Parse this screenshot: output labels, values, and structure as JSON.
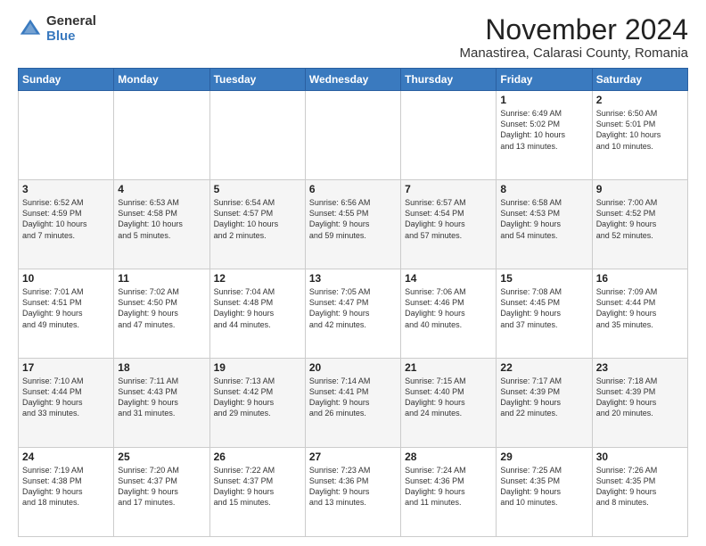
{
  "logo": {
    "general": "General",
    "blue": "Blue"
  },
  "header": {
    "month": "November 2024",
    "location": "Manastirea, Calarasi County, Romania"
  },
  "weekdays": [
    "Sunday",
    "Monday",
    "Tuesday",
    "Wednesday",
    "Thursday",
    "Friday",
    "Saturday"
  ],
  "weeks": [
    [
      {
        "day": "",
        "info": ""
      },
      {
        "day": "",
        "info": ""
      },
      {
        "day": "",
        "info": ""
      },
      {
        "day": "",
        "info": ""
      },
      {
        "day": "",
        "info": ""
      },
      {
        "day": "1",
        "info": "Sunrise: 6:49 AM\nSunset: 5:02 PM\nDaylight: 10 hours\nand 13 minutes."
      },
      {
        "day": "2",
        "info": "Sunrise: 6:50 AM\nSunset: 5:01 PM\nDaylight: 10 hours\nand 10 minutes."
      }
    ],
    [
      {
        "day": "3",
        "info": "Sunrise: 6:52 AM\nSunset: 4:59 PM\nDaylight: 10 hours\nand 7 minutes."
      },
      {
        "day": "4",
        "info": "Sunrise: 6:53 AM\nSunset: 4:58 PM\nDaylight: 10 hours\nand 5 minutes."
      },
      {
        "day": "5",
        "info": "Sunrise: 6:54 AM\nSunset: 4:57 PM\nDaylight: 10 hours\nand 2 minutes."
      },
      {
        "day": "6",
        "info": "Sunrise: 6:56 AM\nSunset: 4:55 PM\nDaylight: 9 hours\nand 59 minutes."
      },
      {
        "day": "7",
        "info": "Sunrise: 6:57 AM\nSunset: 4:54 PM\nDaylight: 9 hours\nand 57 minutes."
      },
      {
        "day": "8",
        "info": "Sunrise: 6:58 AM\nSunset: 4:53 PM\nDaylight: 9 hours\nand 54 minutes."
      },
      {
        "day": "9",
        "info": "Sunrise: 7:00 AM\nSunset: 4:52 PM\nDaylight: 9 hours\nand 52 minutes."
      }
    ],
    [
      {
        "day": "10",
        "info": "Sunrise: 7:01 AM\nSunset: 4:51 PM\nDaylight: 9 hours\nand 49 minutes."
      },
      {
        "day": "11",
        "info": "Sunrise: 7:02 AM\nSunset: 4:50 PM\nDaylight: 9 hours\nand 47 minutes."
      },
      {
        "day": "12",
        "info": "Sunrise: 7:04 AM\nSunset: 4:48 PM\nDaylight: 9 hours\nand 44 minutes."
      },
      {
        "day": "13",
        "info": "Sunrise: 7:05 AM\nSunset: 4:47 PM\nDaylight: 9 hours\nand 42 minutes."
      },
      {
        "day": "14",
        "info": "Sunrise: 7:06 AM\nSunset: 4:46 PM\nDaylight: 9 hours\nand 40 minutes."
      },
      {
        "day": "15",
        "info": "Sunrise: 7:08 AM\nSunset: 4:45 PM\nDaylight: 9 hours\nand 37 minutes."
      },
      {
        "day": "16",
        "info": "Sunrise: 7:09 AM\nSunset: 4:44 PM\nDaylight: 9 hours\nand 35 minutes."
      }
    ],
    [
      {
        "day": "17",
        "info": "Sunrise: 7:10 AM\nSunset: 4:44 PM\nDaylight: 9 hours\nand 33 minutes."
      },
      {
        "day": "18",
        "info": "Sunrise: 7:11 AM\nSunset: 4:43 PM\nDaylight: 9 hours\nand 31 minutes."
      },
      {
        "day": "19",
        "info": "Sunrise: 7:13 AM\nSunset: 4:42 PM\nDaylight: 9 hours\nand 29 minutes."
      },
      {
        "day": "20",
        "info": "Sunrise: 7:14 AM\nSunset: 4:41 PM\nDaylight: 9 hours\nand 26 minutes."
      },
      {
        "day": "21",
        "info": "Sunrise: 7:15 AM\nSunset: 4:40 PM\nDaylight: 9 hours\nand 24 minutes."
      },
      {
        "day": "22",
        "info": "Sunrise: 7:17 AM\nSunset: 4:39 PM\nDaylight: 9 hours\nand 22 minutes."
      },
      {
        "day": "23",
        "info": "Sunrise: 7:18 AM\nSunset: 4:39 PM\nDaylight: 9 hours\nand 20 minutes."
      }
    ],
    [
      {
        "day": "24",
        "info": "Sunrise: 7:19 AM\nSunset: 4:38 PM\nDaylight: 9 hours\nand 18 minutes."
      },
      {
        "day": "25",
        "info": "Sunrise: 7:20 AM\nSunset: 4:37 PM\nDaylight: 9 hours\nand 17 minutes."
      },
      {
        "day": "26",
        "info": "Sunrise: 7:22 AM\nSunset: 4:37 PM\nDaylight: 9 hours\nand 15 minutes."
      },
      {
        "day": "27",
        "info": "Sunrise: 7:23 AM\nSunset: 4:36 PM\nDaylight: 9 hours\nand 13 minutes."
      },
      {
        "day": "28",
        "info": "Sunrise: 7:24 AM\nSunset: 4:36 PM\nDaylight: 9 hours\nand 11 minutes."
      },
      {
        "day": "29",
        "info": "Sunrise: 7:25 AM\nSunset: 4:35 PM\nDaylight: 9 hours\nand 10 minutes."
      },
      {
        "day": "30",
        "info": "Sunrise: 7:26 AM\nSunset: 4:35 PM\nDaylight: 9 hours\nand 8 minutes."
      }
    ]
  ]
}
